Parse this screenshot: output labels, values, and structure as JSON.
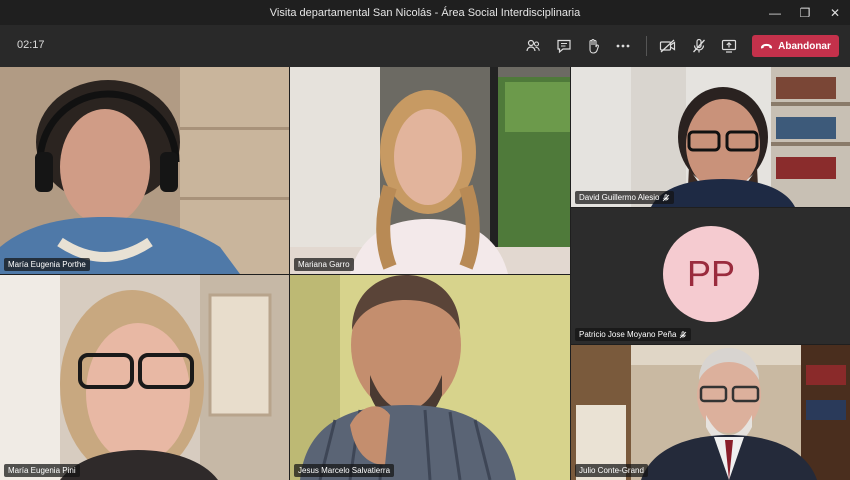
{
  "window": {
    "title": "Visita departamental San Nicolás - Área Social Interdisciplinaria"
  },
  "toolbar": {
    "timer": "02:17",
    "leave_label": "Abandonar",
    "leave_color": "#c4314b",
    "icons": [
      "participants-icon",
      "chat-icon",
      "raise-hand-icon",
      "more-icon",
      "camera-off-icon",
      "mic-off-icon",
      "share-screen-icon"
    ]
  },
  "participants": [
    {
      "name": "María Eugenia Porthe",
      "muted": false
    },
    {
      "name": "Mariana Garro",
      "muted": false
    },
    {
      "name": "David Guillermo Alesio",
      "muted": true
    },
    {
      "name": "Patricio Jose Moyano Peña",
      "muted": true,
      "initials": "PP"
    },
    {
      "name": "María Eugenia Pini",
      "muted": false
    },
    {
      "name": "Jesus Marcelo Salvatierra",
      "muted": false
    },
    {
      "name": "Julio Conte-Grand",
      "muted": false
    }
  ]
}
